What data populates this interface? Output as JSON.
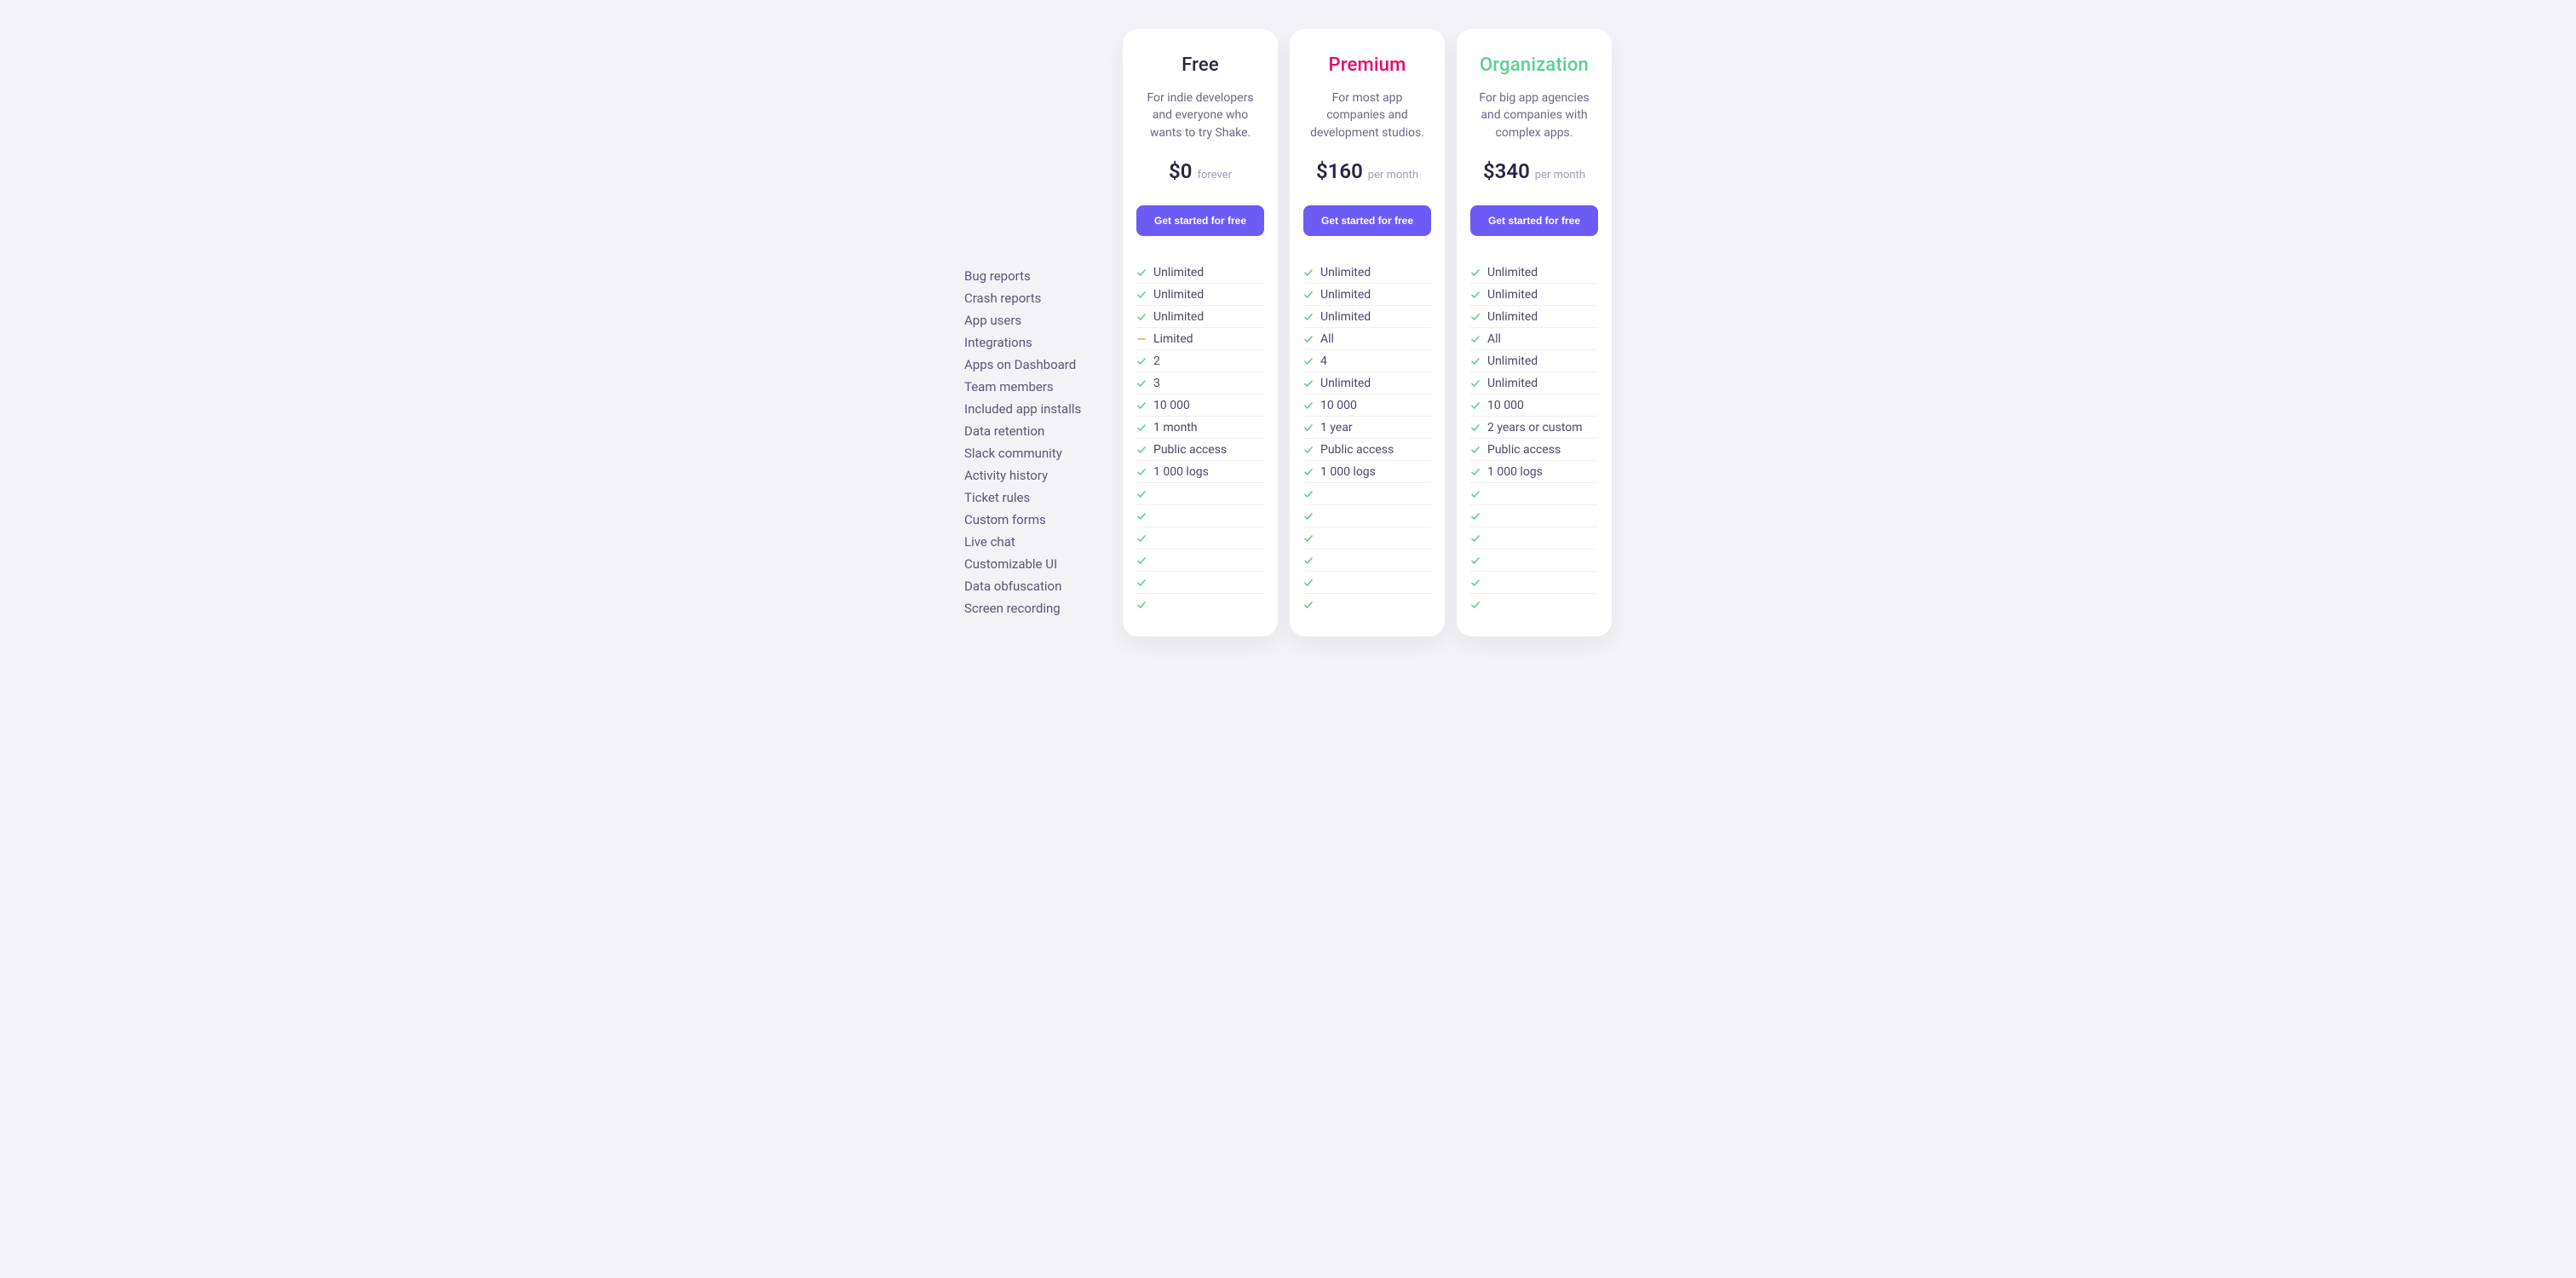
{
  "feature_labels": [
    "Bug reports",
    "Crash reports",
    "App users",
    "Integrations",
    "Apps on Dashboard",
    "Team members",
    "Included app installs",
    "Data retention",
    "Slack community",
    "Activity history",
    "Ticket rules",
    "Custom forms",
    "Live chat",
    "Customizable UI",
    "Data obfuscation",
    "Screen recording"
  ],
  "plans": [
    {
      "id": "free",
      "name": "Free",
      "name_class": "free",
      "description": "For indie developers and everyone who wants to try Shake.",
      "price": "$0",
      "period": "forever",
      "cta": "Get started for free",
      "features": [
        {
          "icon": "check",
          "value": "Unlimited"
        },
        {
          "icon": "check",
          "value": "Unlimited"
        },
        {
          "icon": "check",
          "value": "Unlimited"
        },
        {
          "icon": "dash",
          "value": "Limited"
        },
        {
          "icon": "check",
          "value": "2"
        },
        {
          "icon": "check",
          "value": "3"
        },
        {
          "icon": "check",
          "value": "10 000"
        },
        {
          "icon": "check",
          "value": "1 month"
        },
        {
          "icon": "check",
          "value": "Public access"
        },
        {
          "icon": "check",
          "value": "1 000 logs"
        },
        {
          "icon": "check",
          "value": ""
        },
        {
          "icon": "check",
          "value": ""
        },
        {
          "icon": "check",
          "value": ""
        },
        {
          "icon": "check",
          "value": ""
        },
        {
          "icon": "check",
          "value": ""
        },
        {
          "icon": "check",
          "value": ""
        }
      ]
    },
    {
      "id": "premium",
      "name": "Premium",
      "name_class": "premium",
      "description": "For most app companies and development studios.",
      "price": "$160",
      "period": "per month",
      "cta": "Get started for free",
      "features": [
        {
          "icon": "check",
          "value": "Unlimited"
        },
        {
          "icon": "check",
          "value": "Unlimited"
        },
        {
          "icon": "check",
          "value": "Unlimited"
        },
        {
          "icon": "check",
          "value": "All"
        },
        {
          "icon": "check",
          "value": "4"
        },
        {
          "icon": "check",
          "value": "Unlimited"
        },
        {
          "icon": "check",
          "value": "10 000"
        },
        {
          "icon": "check",
          "value": "1 year"
        },
        {
          "icon": "check",
          "value": "Public access"
        },
        {
          "icon": "check",
          "value": "1 000 logs"
        },
        {
          "icon": "check",
          "value": ""
        },
        {
          "icon": "check",
          "value": ""
        },
        {
          "icon": "check",
          "value": ""
        },
        {
          "icon": "check",
          "value": ""
        },
        {
          "icon": "check",
          "value": ""
        },
        {
          "icon": "check",
          "value": ""
        }
      ]
    },
    {
      "id": "organization",
      "name": "Organization",
      "name_class": "organization",
      "description": "For big app agencies and companies with complex apps.",
      "price": "$340",
      "period": "per month",
      "cta": "Get started for free",
      "features": [
        {
          "icon": "check",
          "value": "Unlimited"
        },
        {
          "icon": "check",
          "value": "Unlimited"
        },
        {
          "icon": "check",
          "value": "Unlimited"
        },
        {
          "icon": "check",
          "value": "All"
        },
        {
          "icon": "check",
          "value": "Unlimited"
        },
        {
          "icon": "check",
          "value": "Unlimited"
        },
        {
          "icon": "check",
          "value": "10 000"
        },
        {
          "icon": "check",
          "value": "2 years or custom"
        },
        {
          "icon": "check",
          "value": "Public access"
        },
        {
          "icon": "check",
          "value": "1 000 logs"
        },
        {
          "icon": "check",
          "value": ""
        },
        {
          "icon": "check",
          "value": ""
        },
        {
          "icon": "check",
          "value": ""
        },
        {
          "icon": "check",
          "value": ""
        },
        {
          "icon": "check",
          "value": ""
        },
        {
          "icon": "check",
          "value": ""
        }
      ]
    }
  ]
}
